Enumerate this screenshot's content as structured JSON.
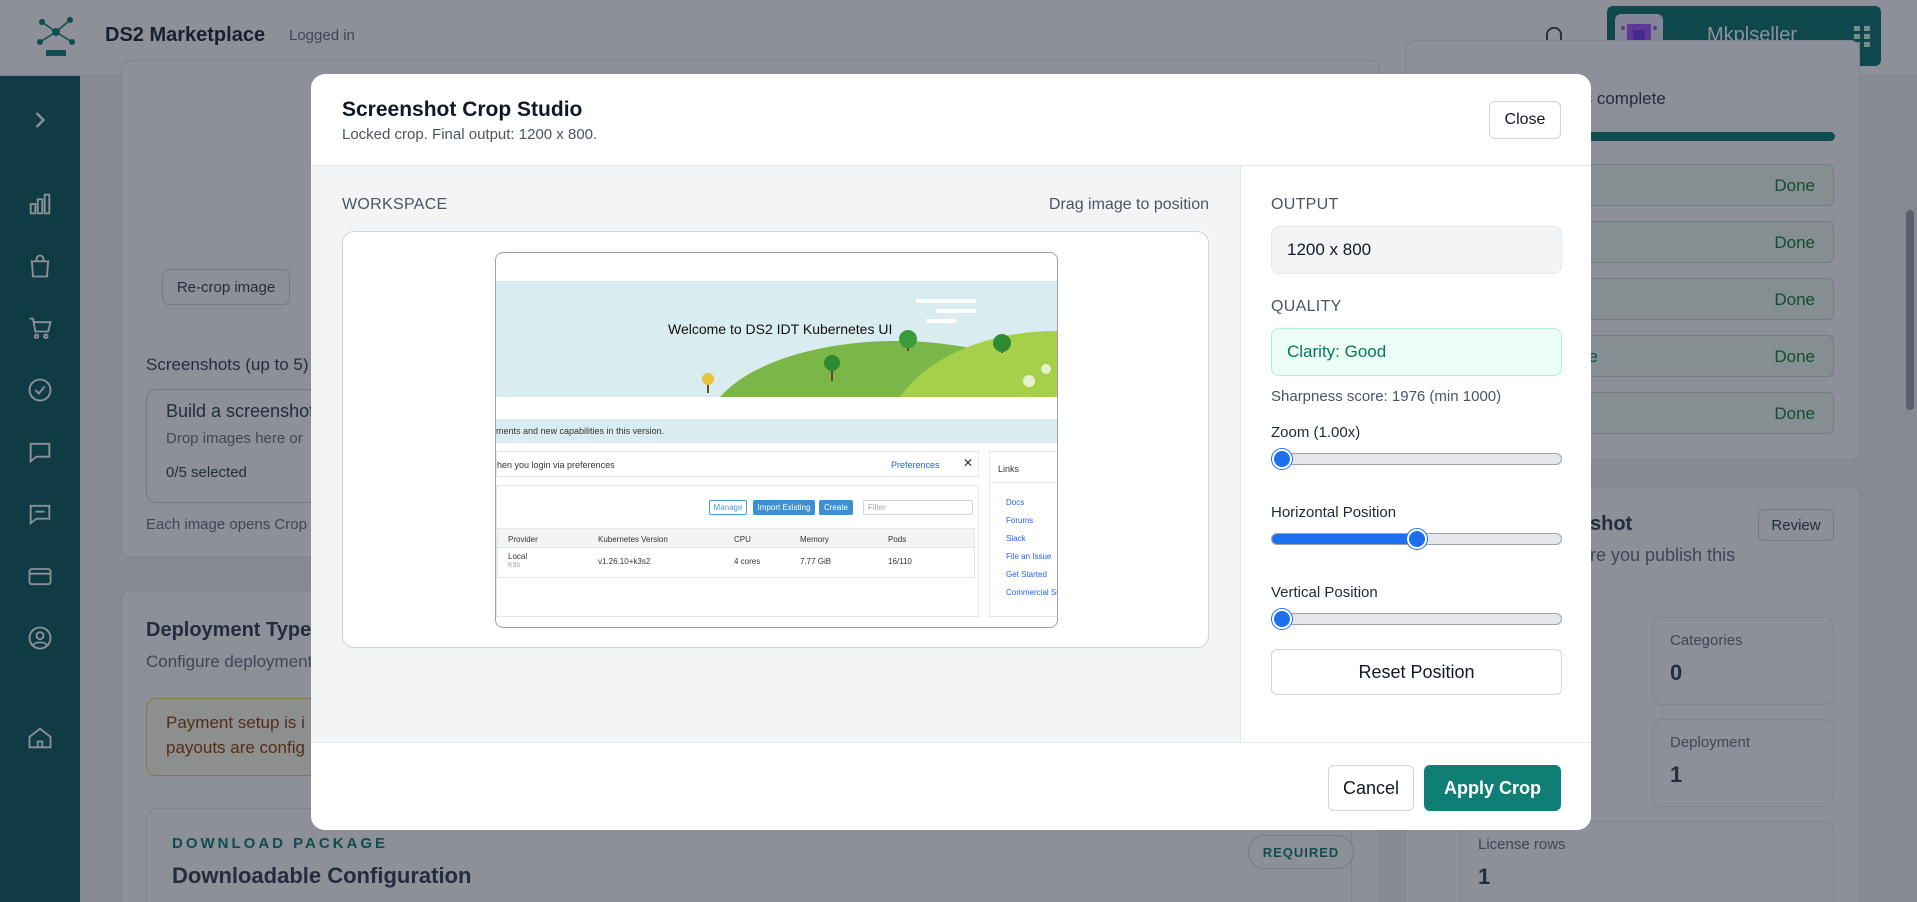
{
  "header": {
    "app_title": "DS2 Marketplace",
    "login_status": "Logged in",
    "user_name": "Mkplseller"
  },
  "background": {
    "recrop_label": "Re-crop image",
    "screenshots_title": "Screenshots (up to 5)",
    "screenshot_builder_title": "Build a screenshot",
    "screenshot_drop_hint": "Drop images here or",
    "screenshot_count": "0/5 selected",
    "screenshot_note": "Each image opens Crop",
    "deployment_title": "Deployment Type",
    "deployment_sub": "Configure deployment",
    "payment_notice_1": "Payment setup is i",
    "payment_notice_2": "payouts are config",
    "download_eyebrow": "DOWNLOAD PACKAGE",
    "download_title": "Downloadable Configuration",
    "required_badge": "REQUIRED",
    "checklist_header": "ems complete",
    "done_rows": [
      "Done",
      "Done",
      "Done",
      "Done",
      "Done"
    ],
    "done_row_prefix_4": "pe",
    "snapshot_title": "shot",
    "snapshot_sub": "re you publish this",
    "review_label": "Review",
    "stats": [
      {
        "label": "Categories",
        "value": "0"
      },
      {
        "label": "Deployment",
        "value": "1"
      },
      {
        "label": "License rows",
        "value": "1"
      }
    ]
  },
  "modal": {
    "title": "Screenshot Crop Studio",
    "subtitle": "Locked crop. Final output: 1200 x 800.",
    "close_label": "Close",
    "workspace_label": "WORKSPACE",
    "workspace_hint": "Drag image to position",
    "output_label": "OUTPUT",
    "output_value": "1200 x 800",
    "quality_label": "QUALITY",
    "quality_value": "Clarity: Good",
    "sharpness_text": "Sharpness score: 1976 (min 1000)",
    "zoom_label": "Zoom (1.00x)",
    "zoom_value": 0,
    "horizontal_label": "Horizontal Position",
    "horizontal_value": 0.5,
    "vertical_label": "Vertical Position",
    "vertical_value": 0,
    "reset_label": "Reset Position",
    "cancel_label": "Cancel",
    "apply_label": "Apply Crop"
  },
  "preview": {
    "welcome": "Welcome to DS2 IDT Kubernetes UI",
    "banner_text": "ments and new capabilities in this version.",
    "login_pref_text": "hen you login via preferences",
    "preferences_link": "Preferences",
    "links_title": "Links",
    "links": [
      "Docs",
      "Forums",
      "Slack",
      "File an Issue",
      "Get Started",
      "Commercial Su"
    ],
    "manage_label": "Manage",
    "import_label": "Import Existing",
    "create_label": "Create",
    "filter_placeholder": "Filter",
    "table_headers": [
      "Provider",
      "Kubernetes Version",
      "CPU",
      "Memory",
      "Pods"
    ],
    "row": {
      "provider": "Local",
      "provider_sub": "K3s",
      "version": "v1.26.10+k3s2",
      "cpu": "4 cores",
      "memory": "7.77 GiB",
      "pods": "16/110"
    }
  },
  "colors": {
    "accent": "#0f7f76",
    "sidebar": "#0f5e5f",
    "slider": "#1d6ff0"
  }
}
